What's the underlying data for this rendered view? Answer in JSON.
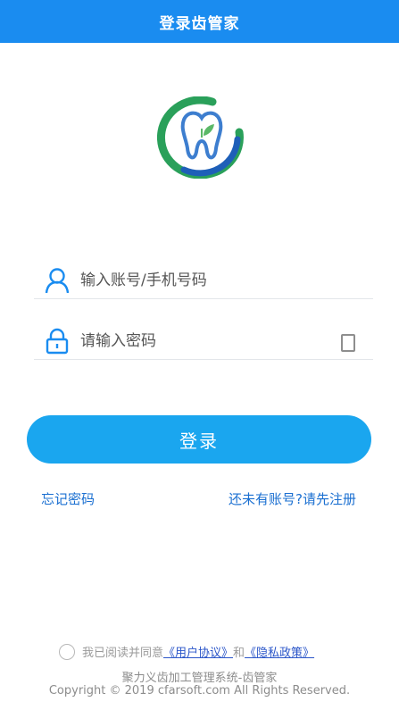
{
  "header": {
    "title": "登录齿管家"
  },
  "logo": {
    "icon": "tooth-logo-icon",
    "colors": {
      "ring_green": "#2aa05a",
      "ring_blue": "#1e5fb8",
      "tooth": "#3d7ecf"
    }
  },
  "form": {
    "account": {
      "placeholder": "输入账号/手机号码",
      "value": ""
    },
    "password": {
      "placeholder": "请输入密码",
      "value": ""
    }
  },
  "login_button": {
    "label": "登录"
  },
  "links": {
    "forgot": "忘记密码",
    "register": "还未有账号?请先注册"
  },
  "agreement": {
    "prefix": "我已阅读并同意",
    "user_agreement": "《用户协议》",
    "and": "和",
    "privacy_policy": "《隐私政策》",
    "checked": false
  },
  "footer": {
    "system_name": "聚力义齿加工管理系统-齿管家",
    "copyright": "Copyright © 2019 cfarsoft.com All Rights Reserved."
  },
  "colors": {
    "primary": "#1a8cf0",
    "button": "#1aa6ef",
    "link": "#1a6fd1"
  }
}
